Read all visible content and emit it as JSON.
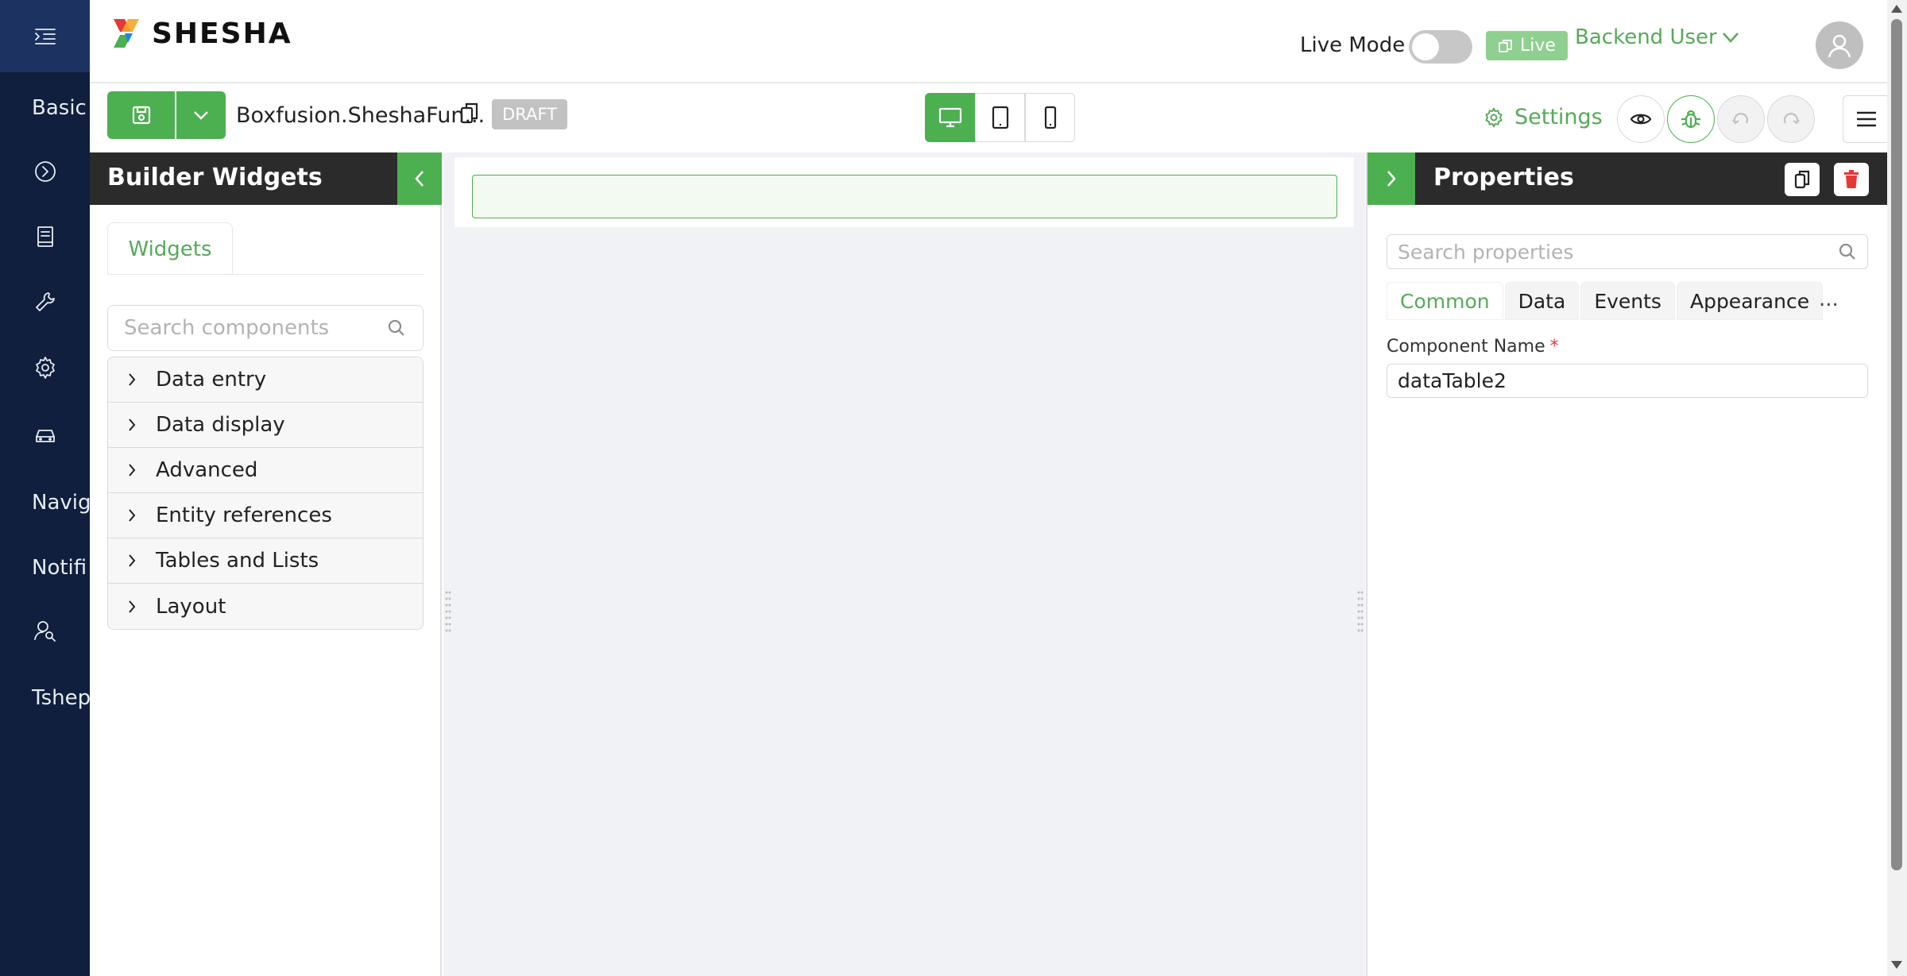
{
  "nav": {
    "items": [
      {
        "type": "text",
        "label": "Basic"
      },
      {
        "type": "icon",
        "icon": "play-circle-icon"
      },
      {
        "type": "icon",
        "icon": "book-icon"
      },
      {
        "type": "icon",
        "icon": "wrench-icon"
      },
      {
        "type": "icon",
        "icon": "gear-icon"
      },
      {
        "type": "icon",
        "icon": "car-icon"
      },
      {
        "type": "text",
        "label": "Navig"
      },
      {
        "type": "text",
        "label": "Notifi"
      },
      {
        "type": "icon",
        "icon": "user-search-icon"
      },
      {
        "type": "text",
        "label": "Tshep"
      }
    ]
  },
  "header": {
    "logo_text": "SHESHA",
    "live_mode_label": "Live Mode",
    "live_mode_on": false,
    "live_badge": "Live",
    "user_name": "Backend User"
  },
  "toolbar": {
    "form_name": "Boxfusion.SheshaFun...",
    "draft_label": "DRAFT",
    "settings_label": "Settings",
    "devices": [
      "desktop",
      "tablet",
      "mobile"
    ],
    "active_device": "desktop"
  },
  "widgets_panel": {
    "title": "Builder Widgets",
    "tab_label": "Widgets",
    "search_placeholder": "Search components",
    "categories": [
      "Data entry",
      "Data display",
      "Advanced",
      "Entity references",
      "Tables and Lists",
      "Layout"
    ]
  },
  "properties_panel": {
    "title": "Properties",
    "search_placeholder": "Search properties",
    "tabs": [
      "Common",
      "Data",
      "Events",
      "Appearance"
    ],
    "active_tab": "Common",
    "more_label": "...",
    "component_name_label": "Component Name",
    "required_marker": "*",
    "component_name_value": "dataTable2"
  },
  "colors": {
    "primary": "#4caf50",
    "nav_bg": "#0f1f3d",
    "panel_header": "#2b2b2b"
  }
}
